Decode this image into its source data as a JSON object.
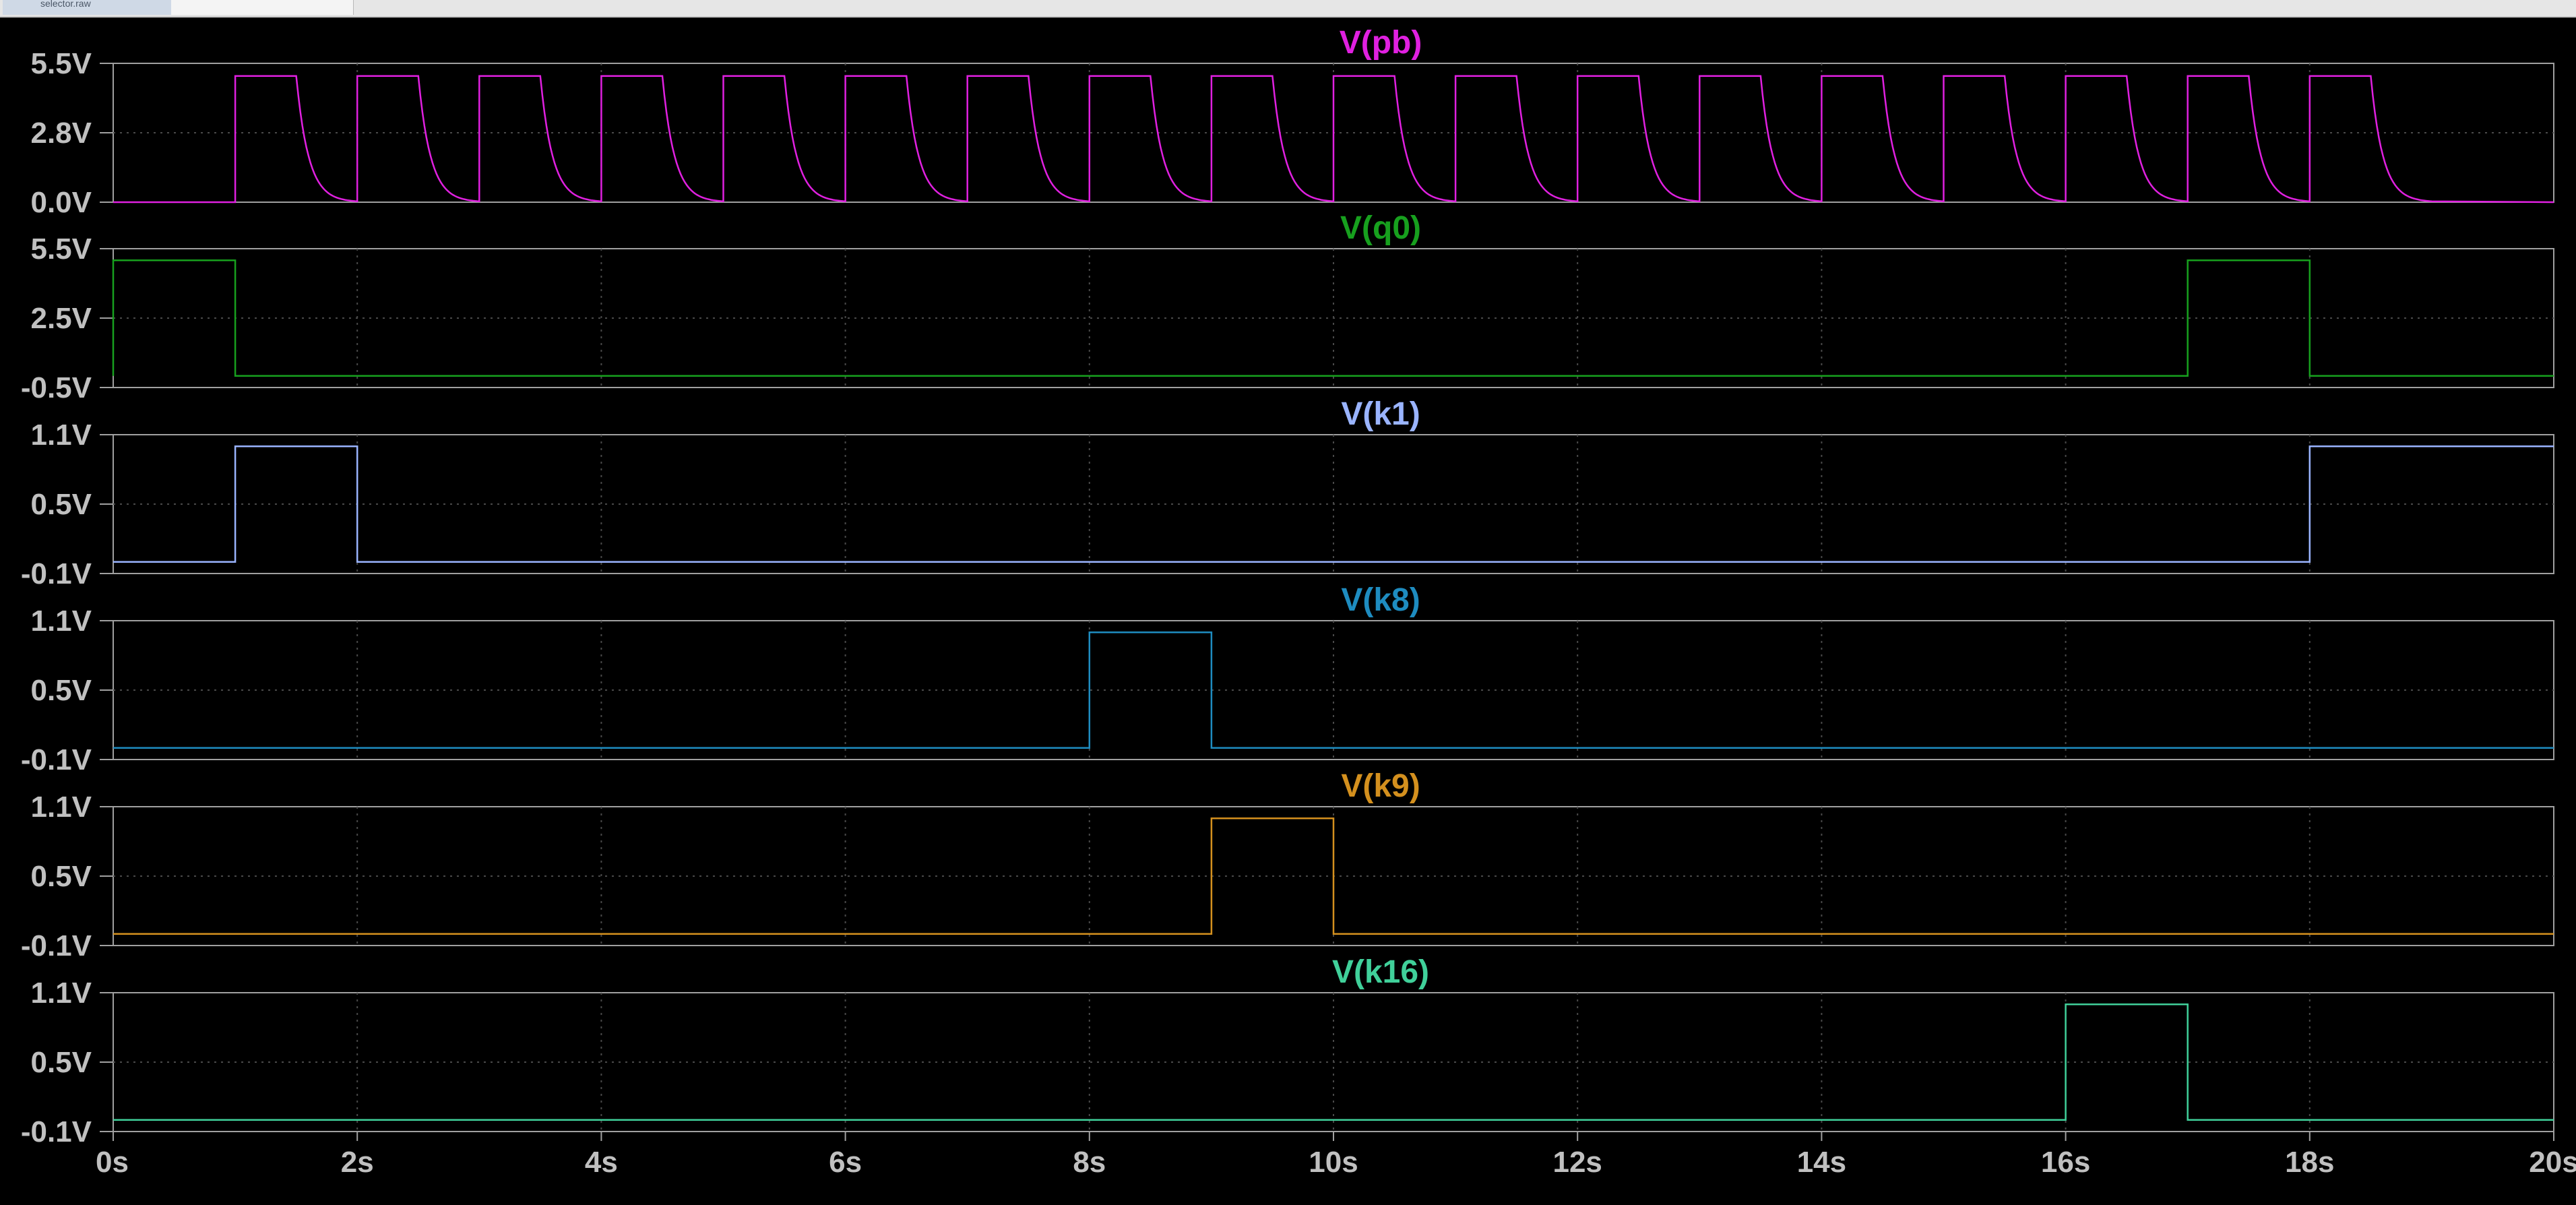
{
  "window": {
    "tab_label": "selector.raw"
  },
  "chart_data": {
    "type": "line",
    "x_ticks": [
      "0s",
      "2s",
      "4s",
      "6s",
      "8s",
      "10s",
      "12s",
      "14s",
      "16s",
      "18s",
      "20s"
    ],
    "xlim": [
      0,
      20
    ],
    "grid": true,
    "panes": [
      {
        "title": "V(pb)",
        "color": "#e020e0",
        "ylim": [
          0.0,
          5.5
        ],
        "y_ticks": [
          "5.5V",
          "2.8V",
          "0.0V"
        ],
        "waveform": "rc_pulse",
        "low": 0.0,
        "high": 5.0,
        "rise_times": [
          1,
          2,
          3,
          4,
          5,
          6,
          7,
          8,
          9,
          10,
          11,
          12,
          13,
          14,
          15,
          16,
          17,
          18
        ],
        "hold": 0.5,
        "decay_tau": 0.1
      },
      {
        "title": "V(q0)",
        "color": "#17a01e",
        "ylim": [
          -0.5,
          5.5
        ],
        "y_ticks": [
          "5.5V",
          "2.5V",
          "-0.5V"
        ],
        "waveform": "square",
        "low": 0.0,
        "high": 5.0,
        "high_intervals": [
          [
            0,
            1
          ],
          [
            17,
            18
          ]
        ]
      },
      {
        "title": "V(k1)",
        "color": "#9ab4ff",
        "ylim": [
          -0.1,
          1.1
        ],
        "y_ticks": [
          "1.1V",
          "0.5V",
          "-0.1V"
        ],
        "waveform": "square",
        "low": 0.0,
        "high": 1.0,
        "high_intervals": [
          [
            1,
            2
          ],
          [
            18,
            20
          ]
        ]
      },
      {
        "title": "V(k8)",
        "color": "#1e8cc0",
        "ylim": [
          -0.1,
          1.1
        ],
        "y_ticks": [
          "1.1V",
          "0.5V",
          "-0.1V"
        ],
        "waveform": "square",
        "low": 0.0,
        "high": 1.0,
        "high_intervals": [
          [
            8,
            9
          ]
        ]
      },
      {
        "title": "V(k9)",
        "color": "#d4901e",
        "ylim": [
          -0.1,
          1.1
        ],
        "y_ticks": [
          "1.1V",
          "0.5V",
          "-0.1V"
        ],
        "waveform": "square",
        "low": 0.0,
        "high": 1.0,
        "high_intervals": [
          [
            9,
            10
          ]
        ]
      },
      {
        "title": "V(k16)",
        "color": "#40d09a",
        "ylim": [
          -0.1,
          1.1
        ],
        "y_ticks": [
          "1.1V",
          "0.5V",
          "-0.1V"
        ],
        "waveform": "square",
        "low": 0.0,
        "high": 1.0,
        "high_intervals": [
          [
            16,
            17
          ]
        ]
      }
    ]
  }
}
